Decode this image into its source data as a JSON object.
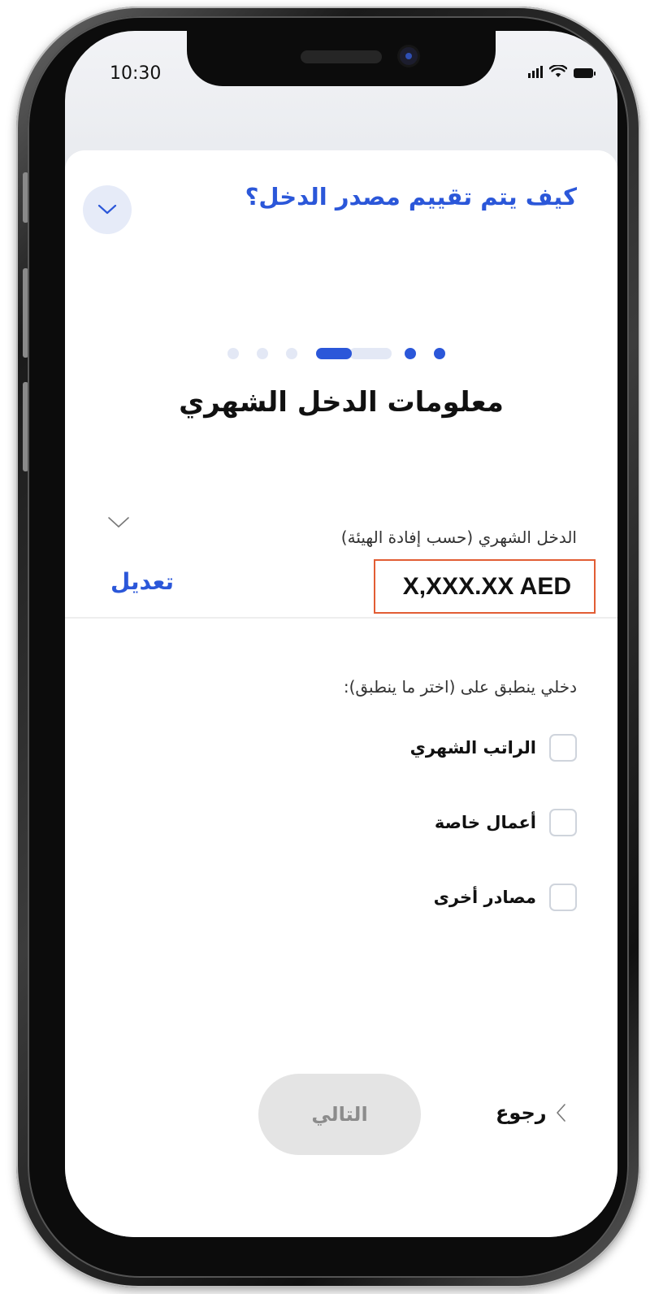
{
  "status_bar": {
    "time": "10:30",
    "signal_icon": "cellular-signal-icon",
    "wifi_icon": "wifi-icon",
    "battery_icon": "battery-icon"
  },
  "help_section": {
    "title": "كيف يتم تقييم مصدر الدخل؟",
    "toggle_icon": "chevron-down-icon"
  },
  "stepper": {
    "total_steps": 7,
    "current_step": 4
  },
  "form": {
    "title": "معلومات الدخل الشهري",
    "monthly_income": {
      "label": "الدخل الشهري (حسب إفادة الهيئة)",
      "value": "X,XXX.XX AED",
      "edit_label": "تعديل",
      "toggle_icon": "chevron-down-icon"
    },
    "income_sources": {
      "label": "دخلي ينطبق على (اختر ما ينطبق):",
      "options": [
        {
          "label": "الراتب الشهري",
          "checked": false
        },
        {
          "label": "أعمال خاصة",
          "checked": false
        },
        {
          "label": "مصادر أخرى",
          "checked": false
        }
      ]
    }
  },
  "footer": {
    "next_label": "التالي",
    "back_label": "رجوع",
    "back_icon": "chevron-left-icon"
  },
  "colors": {
    "accent": "#2b57d9",
    "highlight_border": "#e25d34",
    "disabled_button": "#e4e4e4"
  }
}
